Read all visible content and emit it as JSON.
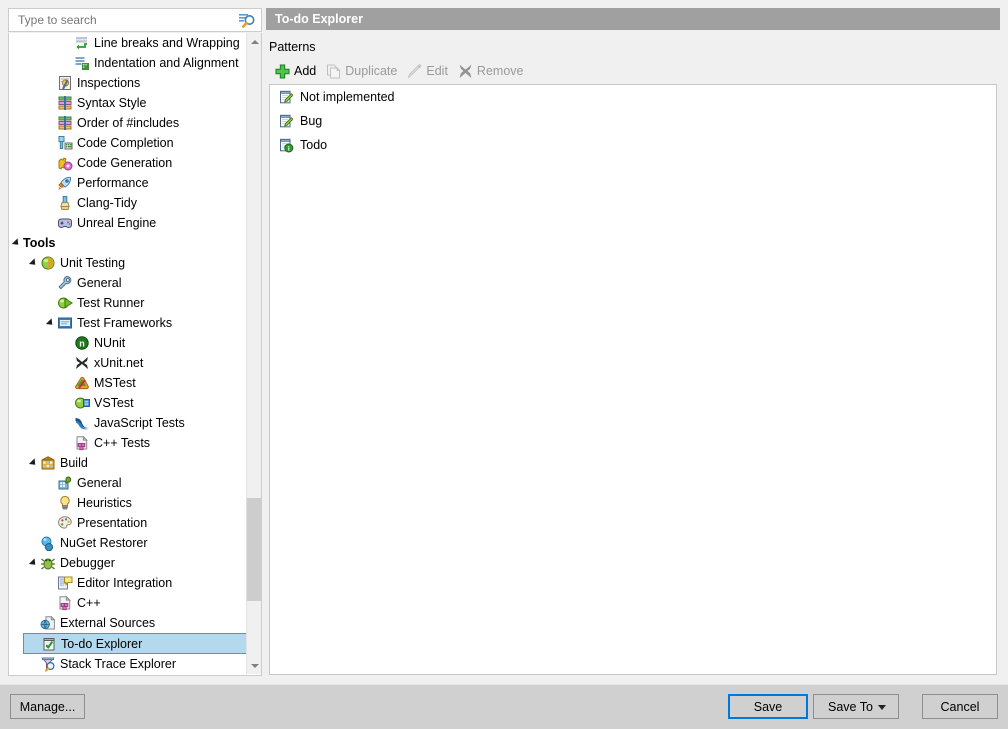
{
  "window": {
    "background": "#f0f0f0"
  },
  "search": {
    "placeholder": "Type to search",
    "value": "",
    "icon": "search-icon"
  },
  "tree": {
    "items": [
      {
        "label": "Line breaks and Wrapping",
        "indent": 3,
        "icon": "line-breaks-icon",
        "expander": "none",
        "selected": false,
        "bold": false
      },
      {
        "label": "Indentation and Alignment",
        "indent": 3,
        "icon": "indentation-icon",
        "expander": "none",
        "selected": false,
        "bold": false
      },
      {
        "label": "Inspections",
        "indent": 2,
        "icon": "inspections-icon",
        "expander": "none",
        "selected": false,
        "bold": false
      },
      {
        "label": "Syntax Style",
        "indent": 2,
        "icon": "syntax-style-icon",
        "expander": "none",
        "selected": false,
        "bold": false
      },
      {
        "label": "Order of #includes",
        "indent": 2,
        "icon": "order-includes-icon",
        "expander": "none",
        "selected": false,
        "bold": false
      },
      {
        "label": "Code Completion",
        "indent": 2,
        "icon": "code-completion-icon",
        "expander": "none",
        "selected": false,
        "bold": false
      },
      {
        "label": "Code Generation",
        "indent": 2,
        "icon": "code-generation-icon",
        "expander": "none",
        "selected": false,
        "bold": false
      },
      {
        "label": "Performance",
        "indent": 2,
        "icon": "performance-icon",
        "expander": "none",
        "selected": false,
        "bold": false
      },
      {
        "label": "Clang-Tidy",
        "indent": 2,
        "icon": "clang-tidy-icon",
        "expander": "none",
        "selected": false,
        "bold": false
      },
      {
        "label": "Unreal Engine",
        "indent": 2,
        "icon": "unreal-engine-icon",
        "expander": "none",
        "selected": false,
        "bold": false
      },
      {
        "label": "Tools",
        "indent": 0,
        "icon": "none",
        "expander": "expanded",
        "selected": false,
        "bold": true
      },
      {
        "label": "Unit Testing",
        "indent": 1,
        "icon": "unit-testing-icon",
        "expander": "expanded",
        "selected": false,
        "bold": false
      },
      {
        "label": "General",
        "indent": 2,
        "icon": "wrench-icon",
        "expander": "none",
        "selected": false,
        "bold": false
      },
      {
        "label": "Test Runner",
        "indent": 2,
        "icon": "test-runner-icon",
        "expander": "none",
        "selected": false,
        "bold": false
      },
      {
        "label": "Test Frameworks",
        "indent": 2,
        "icon": "test-frameworks-icon",
        "expander": "expanded",
        "selected": false,
        "bold": false
      },
      {
        "label": "NUnit",
        "indent": 3,
        "icon": "nunit-icon",
        "expander": "none",
        "selected": false,
        "bold": false
      },
      {
        "label": "xUnit.net",
        "indent": 3,
        "icon": "xunit-icon",
        "expander": "none",
        "selected": false,
        "bold": false
      },
      {
        "label": "MSTest",
        "indent": 3,
        "icon": "mstest-icon",
        "expander": "none",
        "selected": false,
        "bold": false
      },
      {
        "label": "VSTest",
        "indent": 3,
        "icon": "vstest-icon",
        "expander": "none",
        "selected": false,
        "bold": false
      },
      {
        "label": "JavaScript Tests",
        "indent": 3,
        "icon": "javascript-tests-icon",
        "expander": "none",
        "selected": false,
        "bold": false
      },
      {
        "label": "C++ Tests",
        "indent": 3,
        "icon": "cpp-tests-icon",
        "expander": "none",
        "selected": false,
        "bold": false
      },
      {
        "label": "Build",
        "indent": 1,
        "icon": "build-icon",
        "expander": "expanded",
        "selected": false,
        "bold": false
      },
      {
        "label": "General",
        "indent": 2,
        "icon": "build-general-icon",
        "expander": "none",
        "selected": false,
        "bold": false
      },
      {
        "label": "Heuristics",
        "indent": 2,
        "icon": "heuristics-icon",
        "expander": "none",
        "selected": false,
        "bold": false
      },
      {
        "label": "Presentation",
        "indent": 2,
        "icon": "presentation-icon",
        "expander": "none",
        "selected": false,
        "bold": false
      },
      {
        "label": "NuGet Restorer",
        "indent": 1,
        "icon": "nuget-icon",
        "expander": "none",
        "selected": false,
        "bold": false
      },
      {
        "label": "Debugger",
        "indent": 1,
        "icon": "debugger-icon",
        "expander": "expanded",
        "selected": false,
        "bold": false
      },
      {
        "label": "Editor Integration",
        "indent": 2,
        "icon": "editor-integration-icon",
        "expander": "none",
        "selected": false,
        "bold": false
      },
      {
        "label": "C++",
        "indent": 2,
        "icon": "cpp-icon",
        "expander": "none",
        "selected": false,
        "bold": false
      },
      {
        "label": "External Sources",
        "indent": 1,
        "icon": "external-sources-icon",
        "expander": "none",
        "selected": false,
        "bold": false
      },
      {
        "label": "To-do Explorer",
        "indent": 1,
        "icon": "todo-explorer-icon",
        "expander": "none",
        "selected": true,
        "bold": false
      },
      {
        "label": "Stack Trace Explorer",
        "indent": 1,
        "icon": "stack-trace-icon",
        "expander": "none",
        "selected": false,
        "bold": false
      }
    ],
    "scrollbar": {
      "up_icon": "chevron-up-icon",
      "down_icon": "chevron-down-icon"
    }
  },
  "pane": {
    "header_title": "To-do Explorer",
    "header_bg": "#a0a0a0",
    "patterns_label": "Patterns",
    "commands": [
      {
        "label": "Add",
        "icon": "plus-icon",
        "enabled": true
      },
      {
        "label": "Duplicate",
        "icon": "duplicate-icon",
        "enabled": false
      },
      {
        "label": "Edit",
        "icon": "pencil-icon",
        "enabled": false
      },
      {
        "label": "Remove",
        "icon": "cross-icon",
        "enabled": false
      }
    ],
    "patterns": [
      {
        "label": "Not implemented",
        "icon": "pattern-edit-icon"
      },
      {
        "label": "Bug",
        "icon": "pattern-edit-icon"
      },
      {
        "label": "Todo",
        "icon": "pattern-info-icon"
      }
    ]
  },
  "footer": {
    "manage_label": "Manage...",
    "save_label": "Save",
    "save_to_label": "Save To",
    "cancel_label": "Cancel",
    "focus_color": "#0078d7"
  }
}
